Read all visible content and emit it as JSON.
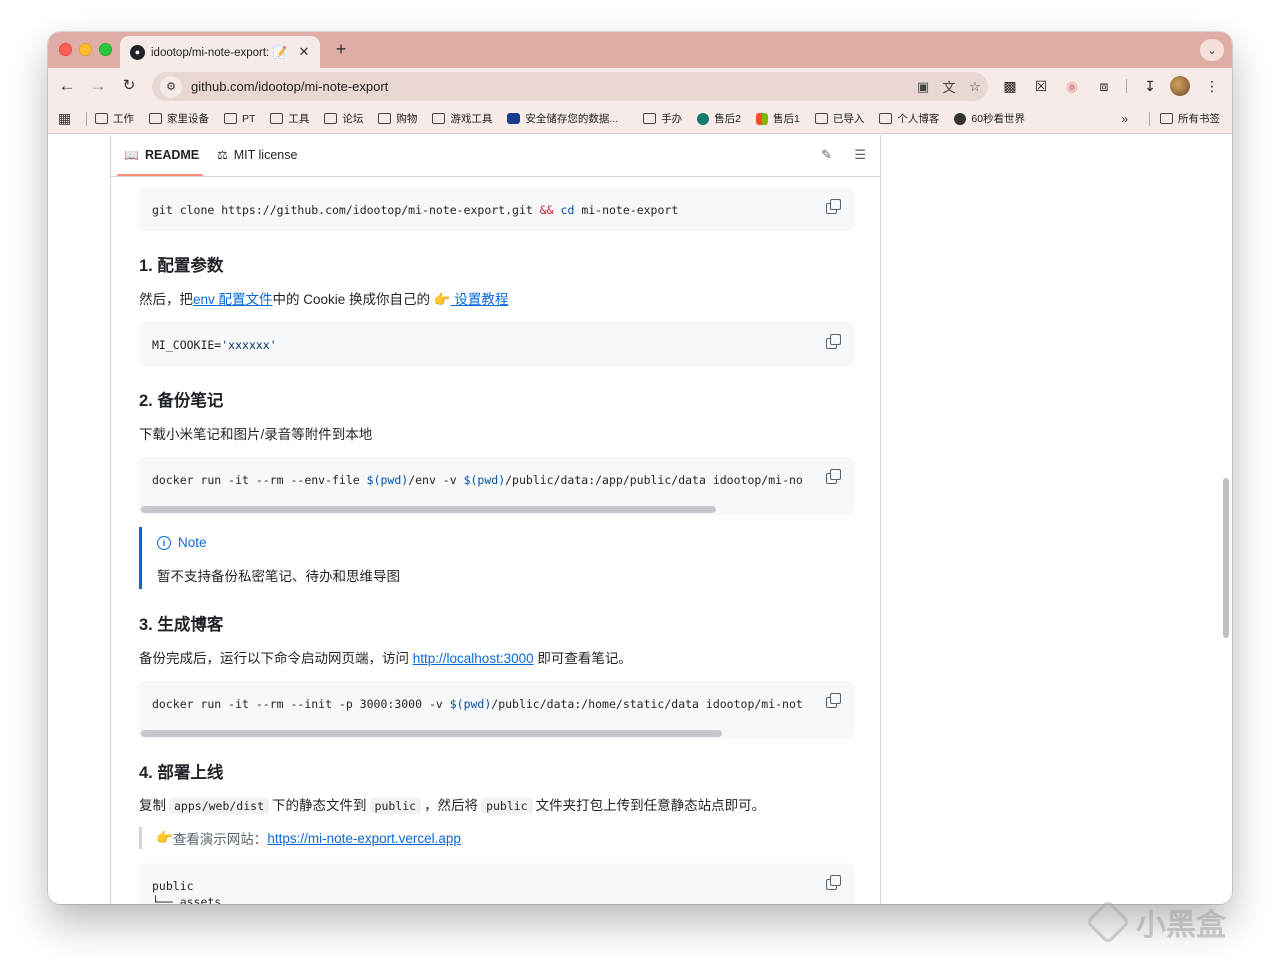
{
  "browser": {
    "tab_title": "idootop/mi-note-export: 📝",
    "tab_close": "✕",
    "new_tab": "+",
    "url": "github.com/idootop/mi-note-export",
    "tab_search_icon": "chevron-down-icon"
  },
  "bookmarks": {
    "items": [
      {
        "label": "工作"
      },
      {
        "label": "家里设备"
      },
      {
        "label": "PT"
      },
      {
        "label": "工具"
      },
      {
        "label": "论坛"
      },
      {
        "label": "购物"
      },
      {
        "label": "游戏工具"
      },
      {
        "label": "安全储存您的数据..."
      },
      {
        "label": "手办"
      },
      {
        "label": "售后2"
      },
      {
        "label": "售后1"
      },
      {
        "label": "已导入"
      },
      {
        "label": "个人博客"
      },
      {
        "label": "60秒看世界"
      }
    ],
    "more": "»",
    "all_bookmarks": "所有书签"
  },
  "readme": {
    "tab_readme": "README",
    "tab_license": "MIT license",
    "clone_cmd_prefix": "git clone https://github.com/idootop/mi-note-export.git ",
    "clone_cmd_op": "&&",
    "clone_cmd_kw": "cd",
    "clone_cmd_suffix": " mi-note-export",
    "h1": "1. 配置参数",
    "p1_a": "然后，把",
    "p1_link1": "env 配置文件",
    "p1_b": "中的 Cookie 换成你自己的 ",
    "p1_emoji": "👉",
    "p1_link2": " 设置教程",
    "cookie_key": "MI_COOKIE=",
    "cookie_val": "'xxxxxx'",
    "h2": "2. 备份笔记",
    "p2": "下载小米笔记和图片/录音等附件到本地",
    "backup_cmd_a": "docker run -it --rm --env-file ",
    "backup_cmd_kw1": "$(pwd)",
    "backup_cmd_b": "/env -v ",
    "backup_cmd_kw2": "$(pwd)",
    "backup_cmd_c": "/public/data:/app/public/data idootop/mi-no",
    "note_title": "Note",
    "note_text": "暂不支持备份私密笔记、待办和思维导图",
    "h3": "3. 生成博客",
    "p3_a": "备份完成后，运行以下命令启动网页端，访问 ",
    "p3_link": "http://localhost:3000",
    "p3_b": " 即可查看笔记。",
    "serve_cmd_a": "docker run -it --rm --init -p 3000:3000 -v ",
    "serve_cmd_kw": "$(pwd)",
    "serve_cmd_b": "/public/data:/home/static/data idootop/mi-not",
    "h4": "4. 部署上线",
    "p4_a": "复制",
    "p4_code1": "apps/web/dist",
    "p4_b": "下的静态文件到",
    "p4_code2": "public",
    "p4_c": "，然后将",
    "p4_code3": "public",
    "p4_d": "文件夹打包上传到任意静态站点即可。",
    "quote_emoji": "👉",
    "quote_text": " 查看演示网站：",
    "quote_link": "https://mi-note-export.vercel.app",
    "tree_line1": "public",
    "tree_line2": "└── assets",
    "backup_scroll_fraction": 0.85,
    "serve_scroll_fraction": 0.86
  },
  "watermark": "小黑盒"
}
